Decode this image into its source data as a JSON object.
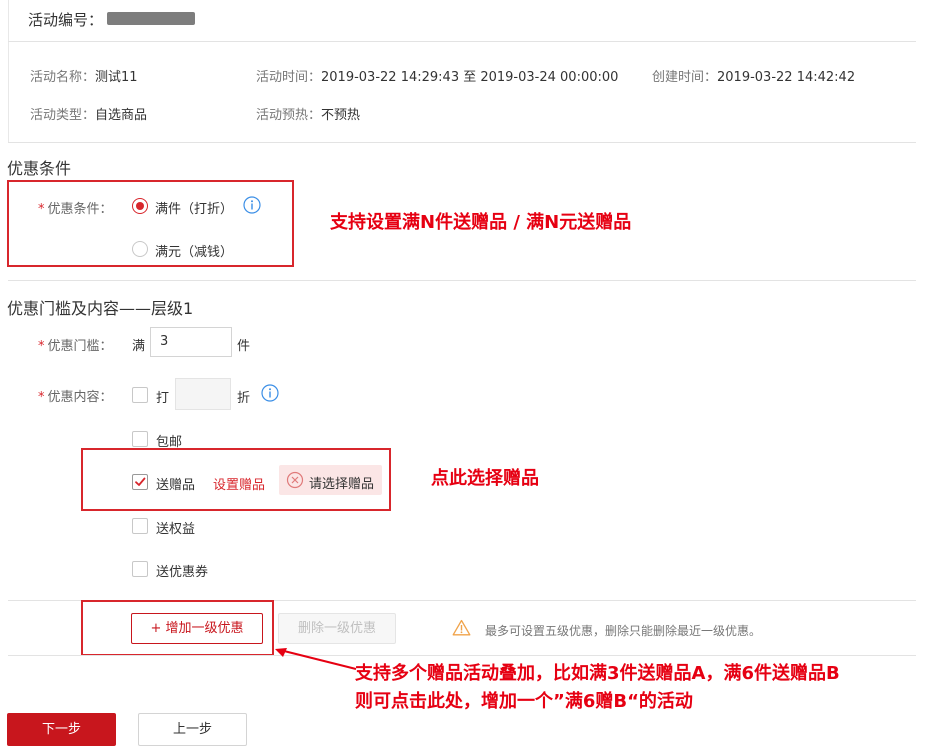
{
  "activity": {
    "id_label": "活动编号：",
    "id_value_masked": "",
    "name_label": "活动名称：",
    "name_value": "测试11",
    "time_label": "活动时间：",
    "time_value": "2019-03-22 14:29:43 至 2019-03-24 00:00:00",
    "created_label": "创建时间：",
    "created_value": "2019-03-22 14:42:42",
    "type_label": "活动类型：",
    "type_value": "自选商品",
    "preheat_label": "活动预热：",
    "preheat_value": "不预热"
  },
  "discount_condition": {
    "section_title": "优惠条件",
    "field_label": "优惠条件：",
    "options": [
      {
        "label": "满件（打折）",
        "selected": true
      },
      {
        "label": "满元（减钱）",
        "selected": false
      }
    ]
  },
  "tier": {
    "section_title": "优惠门槛及内容——层级1",
    "threshold_label": "优惠门槛：",
    "threshold_prefix": "满",
    "threshold_value": "3",
    "threshold_unit": "件",
    "content_label": "优惠内容：",
    "discount_label": "打",
    "discount_value": "",
    "discount_unit": "折",
    "free_shipping_label": "包邮",
    "gift_label": "送赠品",
    "gift_checked": true,
    "set_gift_link": "设置赠品",
    "select_gift_tag": "请选择赠品",
    "benefit_label": "送权益",
    "coupon_label": "送优惠券"
  },
  "tier_actions": {
    "add_label": "+ 增加一级优惠",
    "remove_label": "删除一级优惠",
    "hint": "最多可设置五级优惠，删除只能删除最近一级优惠。"
  },
  "footer": {
    "next_label": "下一步",
    "prev_label": "上一步"
  },
  "annotations": {
    "condition_note": "支持设置满N件送赠品 / 满N元送赠品",
    "gift_note": "点此选择赠品",
    "stack_note_line1": "支持多个赠品活动叠加，比如满3件送赠品A，满6件送赠品B",
    "stack_note_line2": "则可点击此处，增加一个”满6赠B“的活动"
  },
  "colors": {
    "accent_red": "#d8262c",
    "annotation_red": "#e60012",
    "primary_button": "#c8161d"
  }
}
